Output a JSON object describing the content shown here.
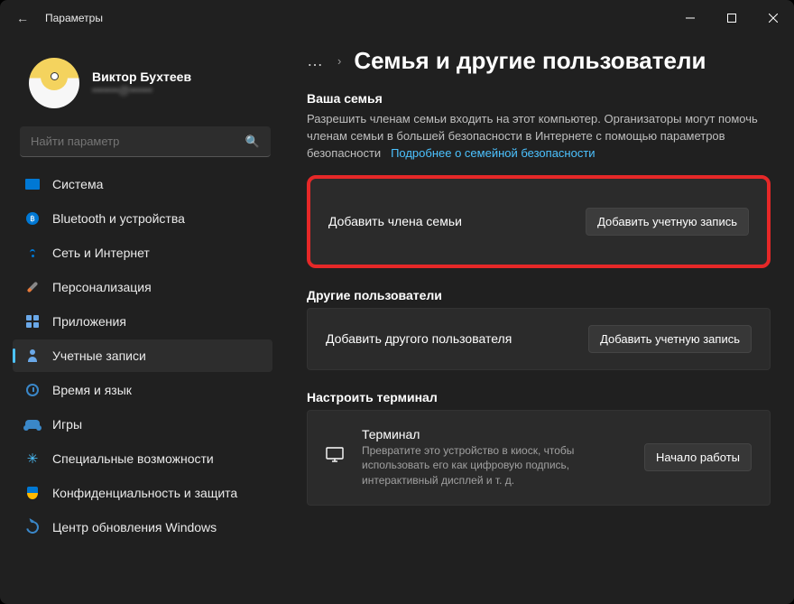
{
  "titlebar": {
    "title": "Параметры"
  },
  "user": {
    "name": "Виктор Бухтеев",
    "email": "•••••••@••••••"
  },
  "search": {
    "placeholder": "Найти параметр"
  },
  "nav": [
    {
      "label": "Система"
    },
    {
      "label": "Bluetooth и устройства"
    },
    {
      "label": "Сеть и Интернет"
    },
    {
      "label": "Персонализация"
    },
    {
      "label": "Приложения"
    },
    {
      "label": "Учетные записи"
    },
    {
      "label": "Время и язык"
    },
    {
      "label": "Игры"
    },
    {
      "label": "Специальные возможности"
    },
    {
      "label": "Конфиденциальность и защита"
    },
    {
      "label": "Центр обновления Windows"
    }
  ],
  "page": {
    "title": "Семья и другие пользователи"
  },
  "family": {
    "heading": "Ваша семья",
    "description": "Разрешить членам семьи входить на этот компьютер. Организаторы могут помочь членам семьи в большей безопасности в Интернете с помощью параметров безопасности",
    "link": "Подробнее о семейной безопасности",
    "add_label": "Добавить члена семьи",
    "add_button": "Добавить учетную запись"
  },
  "other": {
    "heading": "Другие пользователи",
    "add_label": "Добавить другого пользователя",
    "add_button": "Добавить учетную запись"
  },
  "kiosk": {
    "heading": "Настроить терминал",
    "title": "Терминал",
    "description": "Превратите это устройство в киоск, чтобы использовать его как цифровую подпись, интерактивный дисплей и т. д.",
    "button": "Начало работы"
  }
}
